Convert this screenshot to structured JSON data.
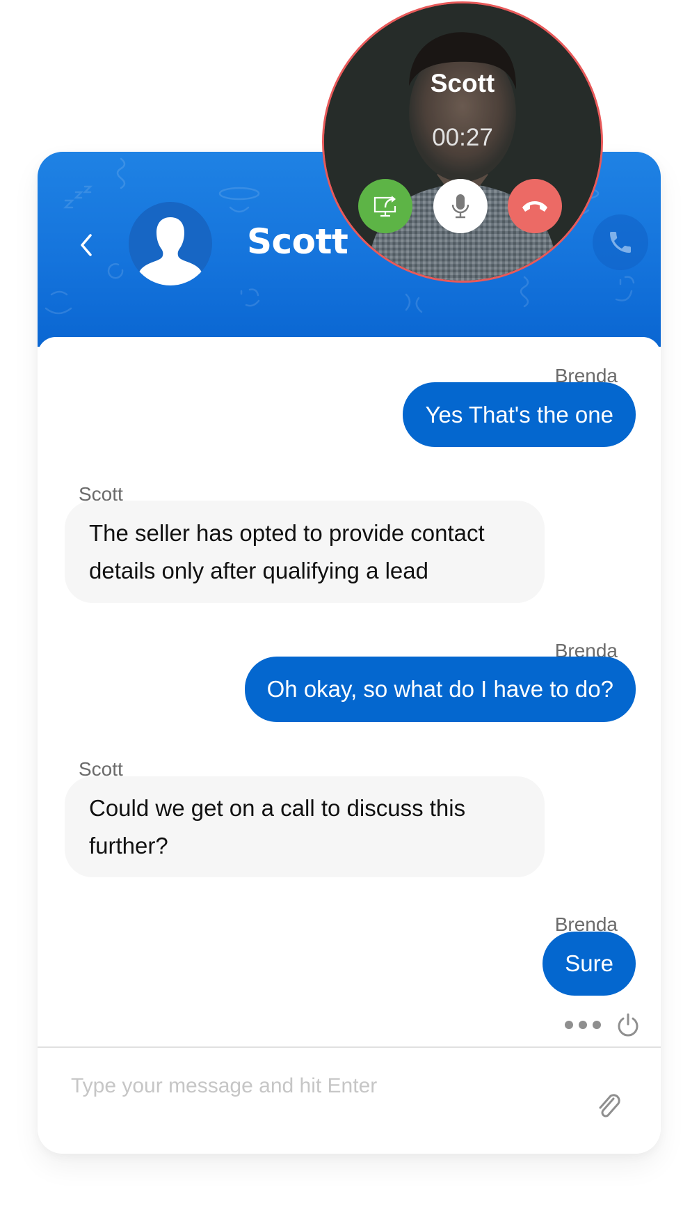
{
  "colors": {
    "header_top": "#1f82e4",
    "header_bottom": "#0a66d2",
    "outgoing_bubble": "#0467cf",
    "incoming_bubble": "#f6f6f6",
    "call_border": "#e85a5a",
    "share_button": "#5db446",
    "end_call_button": "#ec6a65"
  },
  "header": {
    "contact_name": "Scott",
    "back_icon": "chevron-left-icon",
    "avatar_icon": "person-silhouette-icon",
    "call_icon": "phone-icon"
  },
  "call": {
    "caller_name": "Scott",
    "duration": "00:27",
    "buttons": [
      {
        "name": "share-screen",
        "icon": "screen-share-icon"
      },
      {
        "name": "mute",
        "icon": "microphone-icon"
      },
      {
        "name": "end-call",
        "icon": "hang-up-icon"
      }
    ]
  },
  "messages": [
    {
      "sender": "Brenda",
      "direction": "outgoing",
      "text": "Yes That's the one"
    },
    {
      "sender": "Scott",
      "direction": "incoming",
      "text": "The seller has opted to provide contact details only after qualifying a lead"
    },
    {
      "sender": "Brenda",
      "direction": "outgoing",
      "text": "Oh okay, so what do I have to do?"
    },
    {
      "sender": "Scott",
      "direction": "incoming",
      "text": "Could we get on a call to discuss this further?"
    },
    {
      "sender": "Brenda",
      "direction": "outgoing",
      "text": "Sure"
    }
  ],
  "footer": {
    "more_icon": "more-dots-icon",
    "end_chat_icon": "power-icon",
    "input_placeholder": "Type your message and hit Enter",
    "input_value": "",
    "attach_icon": "paperclip-icon"
  }
}
